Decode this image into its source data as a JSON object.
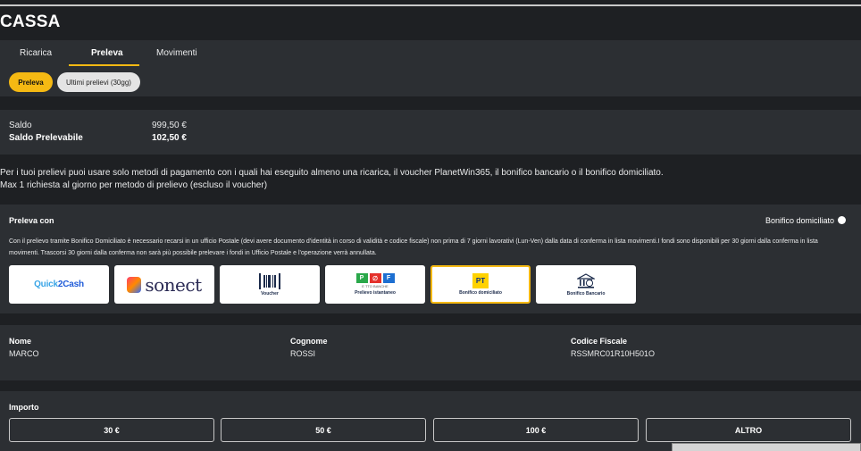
{
  "page": {
    "title": "CASSA"
  },
  "tabs": [
    {
      "label": "Ricarica"
    },
    {
      "label": "Preleva"
    },
    {
      "label": "Movimenti"
    }
  ],
  "subtabs": [
    {
      "label": "Preleva"
    },
    {
      "label": "Ultimi prelievi (30gg)"
    }
  ],
  "saldo": {
    "saldo_label": "Saldo",
    "saldo_value": "999,50 €",
    "prelevabile_label": "Saldo Prelevabile",
    "prelevabile_value": "102,50 €"
  },
  "info": {
    "line1": "Per i tuoi prelievi puoi usare solo metodi di pagamento con i quali hai eseguito almeno una ricarica, il voucher PlanetWin365, il bonifico bancario o il bonifico domiciliato.",
    "line2": "Max 1 richiesta al giorno per metodo di prelievo (escluso il voucher)"
  },
  "preleva_con": {
    "title": "Preleva con",
    "selected_method": "Bonifico domiciliato",
    "description": "Con il prelievo tramite Bonifico Domiciliato è necessario recarsi in un ufficio Postale (devi avere documento d'identità in corso di validità e codice fiscale) non prima di 7 giorni lavorativi (Lun-Ven) dalla data di conferma in lista movimenti.I fondi sono disponibili per 30 giorni dalla conferma in lista movimenti. Trascorsi 30 giorni dalla conferma non sarà più possibile prelevare i fondi in Ufficio Postale e l'operazione verrà annullata.",
    "methods": [
      {
        "name": "quick2cash",
        "logo_text_a": "Quick",
        "logo_text_b": "2Cash"
      },
      {
        "name": "sonect",
        "logo_text": "sonect"
      },
      {
        "name": "voucher",
        "caption": "Voucher"
      },
      {
        "name": "prelievo-istantaneo",
        "caption": "Prelievo istantaneo",
        "logo_a": "P",
        "logo_b": "∅",
        "logo_c": "F",
        "sub": "E TTO BANCHE"
      },
      {
        "name": "bonifico-domiciliato",
        "caption": "Bonifico domiciliato",
        "logo_text": "PT"
      },
      {
        "name": "bonifico-bancario",
        "caption": "Bonifico Bancario"
      }
    ]
  },
  "user": {
    "nome_label": "Nome",
    "nome_value": "MARCO",
    "cognome_label": "Cognome",
    "cognome_value": "ROSSI",
    "cf_label": "Codice Fiscale",
    "cf_value": "RSSMRC01R10H501O"
  },
  "importo": {
    "title": "Importo",
    "options": [
      "30 €",
      "50 €",
      "100 €",
      "ALTRO"
    ]
  },
  "colors": {
    "accent": "#f5b913",
    "panel": "#2c2f33",
    "background": "#1e2023"
  }
}
